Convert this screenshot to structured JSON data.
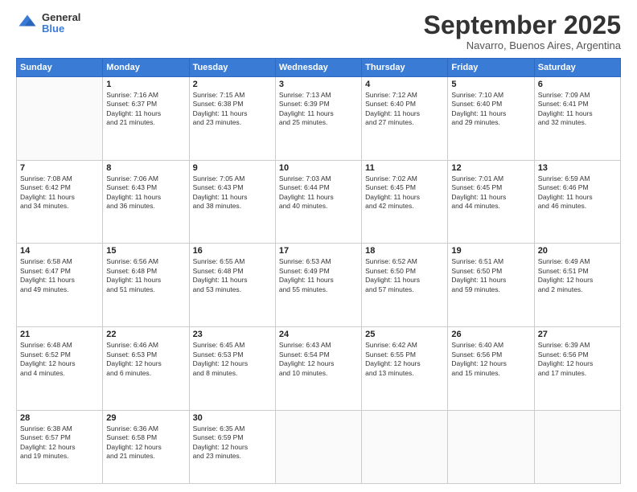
{
  "logo": {
    "general": "General",
    "blue": "Blue"
  },
  "header": {
    "month": "September 2025",
    "location": "Navarro, Buenos Aires, Argentina"
  },
  "days_of_week": [
    "Sunday",
    "Monday",
    "Tuesday",
    "Wednesday",
    "Thursday",
    "Friday",
    "Saturday"
  ],
  "weeks": [
    [
      {
        "day": "",
        "info": ""
      },
      {
        "day": "1",
        "info": "Sunrise: 7:16 AM\nSunset: 6:37 PM\nDaylight: 11 hours\nand 21 minutes."
      },
      {
        "day": "2",
        "info": "Sunrise: 7:15 AM\nSunset: 6:38 PM\nDaylight: 11 hours\nand 23 minutes."
      },
      {
        "day": "3",
        "info": "Sunrise: 7:13 AM\nSunset: 6:39 PM\nDaylight: 11 hours\nand 25 minutes."
      },
      {
        "day": "4",
        "info": "Sunrise: 7:12 AM\nSunset: 6:40 PM\nDaylight: 11 hours\nand 27 minutes."
      },
      {
        "day": "5",
        "info": "Sunrise: 7:10 AM\nSunset: 6:40 PM\nDaylight: 11 hours\nand 29 minutes."
      },
      {
        "day": "6",
        "info": "Sunrise: 7:09 AM\nSunset: 6:41 PM\nDaylight: 11 hours\nand 32 minutes."
      }
    ],
    [
      {
        "day": "7",
        "info": "Sunrise: 7:08 AM\nSunset: 6:42 PM\nDaylight: 11 hours\nand 34 minutes."
      },
      {
        "day": "8",
        "info": "Sunrise: 7:06 AM\nSunset: 6:43 PM\nDaylight: 11 hours\nand 36 minutes."
      },
      {
        "day": "9",
        "info": "Sunrise: 7:05 AM\nSunset: 6:43 PM\nDaylight: 11 hours\nand 38 minutes."
      },
      {
        "day": "10",
        "info": "Sunrise: 7:03 AM\nSunset: 6:44 PM\nDaylight: 11 hours\nand 40 minutes."
      },
      {
        "day": "11",
        "info": "Sunrise: 7:02 AM\nSunset: 6:45 PM\nDaylight: 11 hours\nand 42 minutes."
      },
      {
        "day": "12",
        "info": "Sunrise: 7:01 AM\nSunset: 6:45 PM\nDaylight: 11 hours\nand 44 minutes."
      },
      {
        "day": "13",
        "info": "Sunrise: 6:59 AM\nSunset: 6:46 PM\nDaylight: 11 hours\nand 46 minutes."
      }
    ],
    [
      {
        "day": "14",
        "info": "Sunrise: 6:58 AM\nSunset: 6:47 PM\nDaylight: 11 hours\nand 49 minutes."
      },
      {
        "day": "15",
        "info": "Sunrise: 6:56 AM\nSunset: 6:48 PM\nDaylight: 11 hours\nand 51 minutes."
      },
      {
        "day": "16",
        "info": "Sunrise: 6:55 AM\nSunset: 6:48 PM\nDaylight: 11 hours\nand 53 minutes."
      },
      {
        "day": "17",
        "info": "Sunrise: 6:53 AM\nSunset: 6:49 PM\nDaylight: 11 hours\nand 55 minutes."
      },
      {
        "day": "18",
        "info": "Sunrise: 6:52 AM\nSunset: 6:50 PM\nDaylight: 11 hours\nand 57 minutes."
      },
      {
        "day": "19",
        "info": "Sunrise: 6:51 AM\nSunset: 6:50 PM\nDaylight: 11 hours\nand 59 minutes."
      },
      {
        "day": "20",
        "info": "Sunrise: 6:49 AM\nSunset: 6:51 PM\nDaylight: 12 hours\nand 2 minutes."
      }
    ],
    [
      {
        "day": "21",
        "info": "Sunrise: 6:48 AM\nSunset: 6:52 PM\nDaylight: 12 hours\nand 4 minutes."
      },
      {
        "day": "22",
        "info": "Sunrise: 6:46 AM\nSunset: 6:53 PM\nDaylight: 12 hours\nand 6 minutes."
      },
      {
        "day": "23",
        "info": "Sunrise: 6:45 AM\nSunset: 6:53 PM\nDaylight: 12 hours\nand 8 minutes."
      },
      {
        "day": "24",
        "info": "Sunrise: 6:43 AM\nSunset: 6:54 PM\nDaylight: 12 hours\nand 10 minutes."
      },
      {
        "day": "25",
        "info": "Sunrise: 6:42 AM\nSunset: 6:55 PM\nDaylight: 12 hours\nand 13 minutes."
      },
      {
        "day": "26",
        "info": "Sunrise: 6:40 AM\nSunset: 6:56 PM\nDaylight: 12 hours\nand 15 minutes."
      },
      {
        "day": "27",
        "info": "Sunrise: 6:39 AM\nSunset: 6:56 PM\nDaylight: 12 hours\nand 17 minutes."
      }
    ],
    [
      {
        "day": "28",
        "info": "Sunrise: 6:38 AM\nSunset: 6:57 PM\nDaylight: 12 hours\nand 19 minutes."
      },
      {
        "day": "29",
        "info": "Sunrise: 6:36 AM\nSunset: 6:58 PM\nDaylight: 12 hours\nand 21 minutes."
      },
      {
        "day": "30",
        "info": "Sunrise: 6:35 AM\nSunset: 6:59 PM\nDaylight: 12 hours\nand 23 minutes."
      },
      {
        "day": "",
        "info": ""
      },
      {
        "day": "",
        "info": ""
      },
      {
        "day": "",
        "info": ""
      },
      {
        "day": "",
        "info": ""
      }
    ]
  ]
}
